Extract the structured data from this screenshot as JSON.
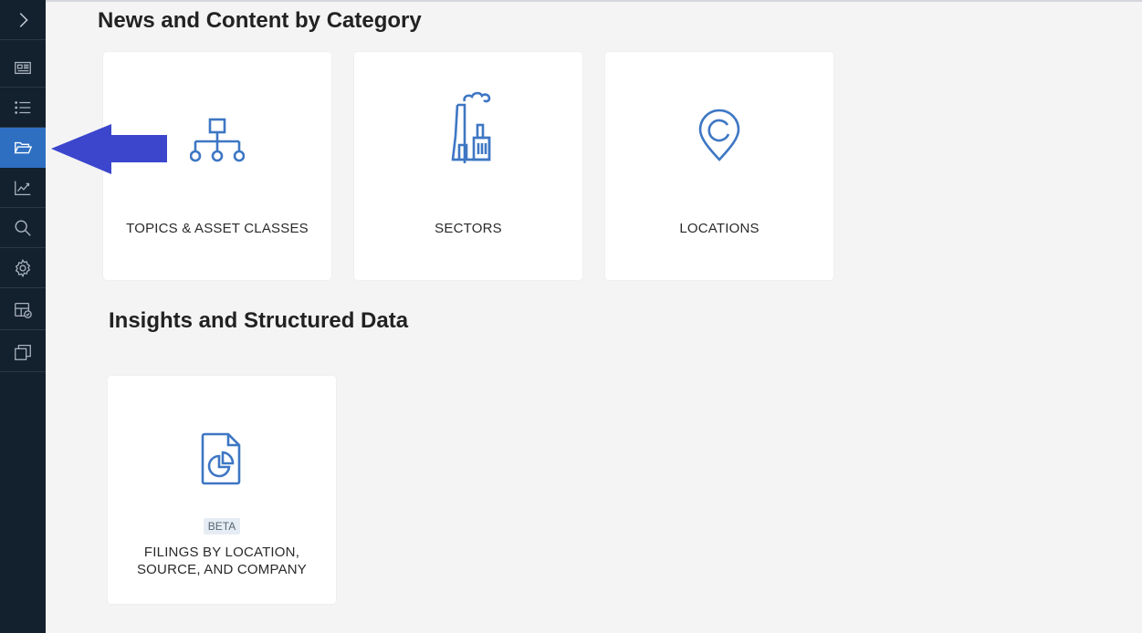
{
  "sections": {
    "news_title": "News and Content by Category",
    "insights_title": "Insights and Structured Data"
  },
  "cards": {
    "topics": {
      "label": "TOPICS & ASSET CLASSES",
      "icon": "hierarchy-icon"
    },
    "sectors": {
      "label": "SECTORS",
      "icon": "factory-icon"
    },
    "locations": {
      "label": "LOCATIONS",
      "icon": "location-pin-icon"
    },
    "filings": {
      "badge": "BETA",
      "label_line1": "FILINGS BY LOCATION,",
      "label_line2": "SOURCE, AND COMPANY",
      "icon": "document-chart-icon"
    }
  },
  "sidebar": {
    "items": [
      "expand-icon",
      "newspaper-icon",
      "list-icon",
      "folder-open-icon",
      "trend-chart-icon",
      "search-icon",
      "gear-icon",
      "layout-check-icon",
      "stacked-windows-icon"
    ],
    "active": "folder-open-icon"
  },
  "colors": {
    "sidebar_bg": "#13202e",
    "sidebar_active": "#2f6fc2",
    "icon_blue": "#3e77c4",
    "arrow": "#3b46cc",
    "page_bg": "#f4f4f4"
  }
}
